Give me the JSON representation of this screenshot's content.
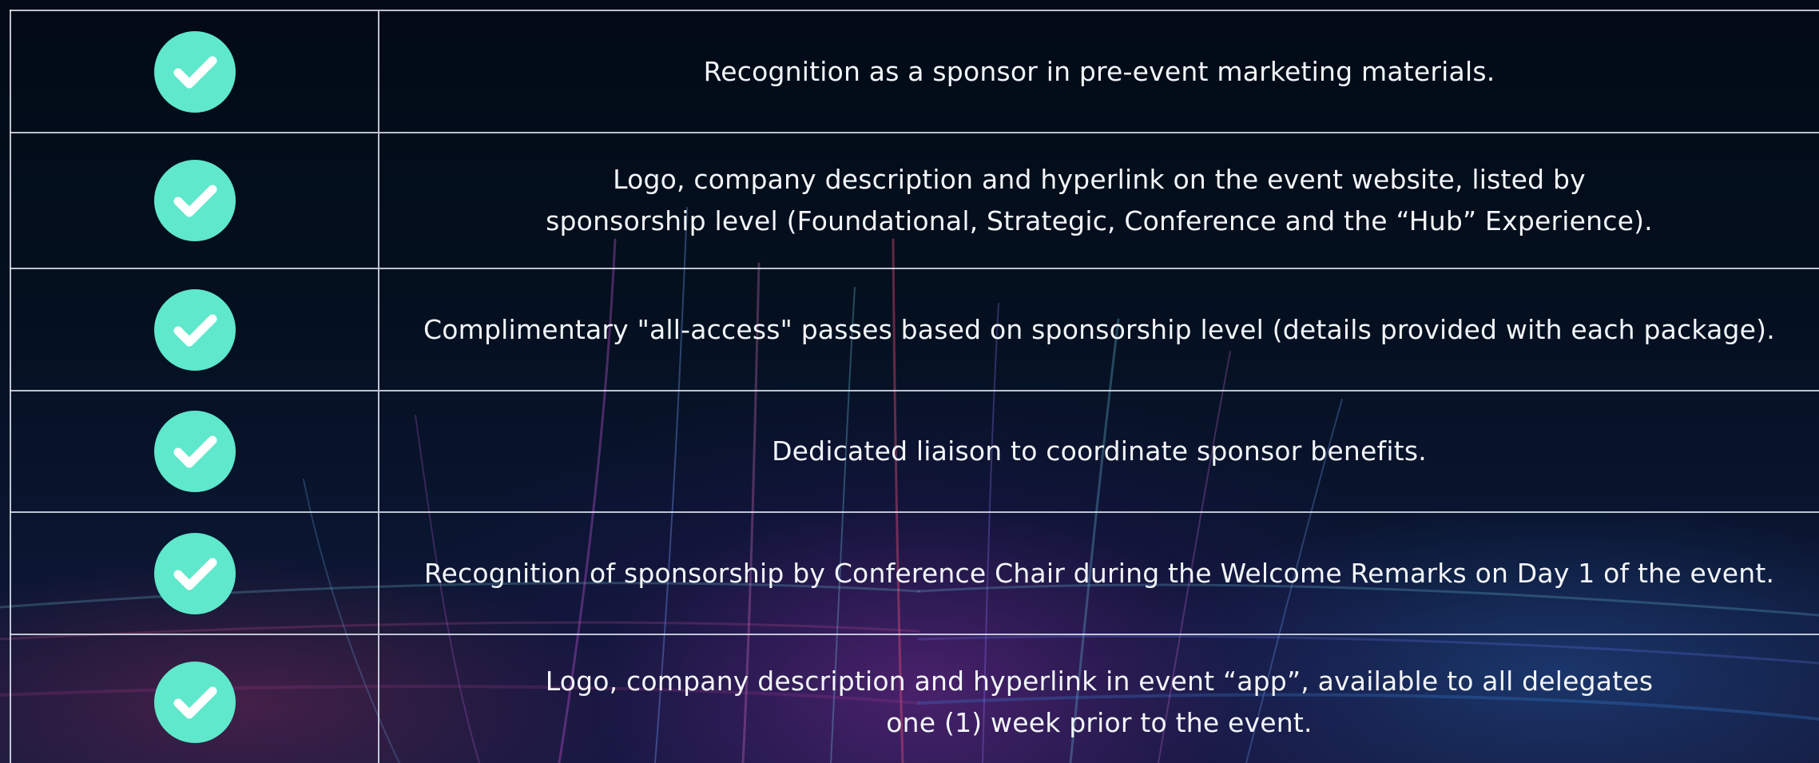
{
  "colors": {
    "check_background": "#5fe8cb",
    "check_mark": "#ffffff",
    "grid_line": "#dce4f0",
    "text": "#f2f5fa",
    "background": "#040b18"
  },
  "icon": "checkmark-circle-icon",
  "benefits": [
    {
      "text": "Recognition as a sponsor in pre-event marketing materials."
    },
    {
      "text": "Logo, company description and hyperlink on the event website, listed by sponsorship level (Foundational, Strategic, Conference and the “Hub” Experience)."
    },
    {
      "text": "Complimentary \"all-access\" passes based on sponsorship level (details provided with each package)."
    },
    {
      "text": "Dedicated liaison to coordinate sponsor benefits."
    },
    {
      "text": "Recognition of sponsorship by Conference Chair during the Welcome Remarks on Day 1 of the event."
    },
    {
      "text": "Logo, company description and hyperlink in event “app”, available to all delegates one (1) week prior to the event."
    }
  ]
}
